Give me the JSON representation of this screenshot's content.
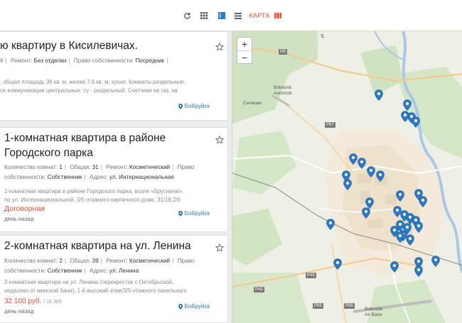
{
  "toolbar": {
    "refresh_icon": "refresh-icon",
    "grid_icon": "grid-view-icon",
    "tile_icon": "tile-view-icon",
    "list_icon": "list-view-icon",
    "map_label": "КАРТА",
    "map_icon": "map-icon",
    "active_color": "#2a7ac9",
    "accent_color": "#e0533b"
  },
  "listings": [
    {
      "title": "ю квартиру в Кисилевичах.",
      "params_1": "6",
      "params_1_label_repair": "Ремонт:",
      "params_1_repair": "Без отделки",
      "params_1_label_ownership": "Право собственности:",
      "params_1_ownership": "Посредник",
      "desc_1": ", общая площадь 36 кв. м, жилая 7,6 кв. м, кухня. Комнаты раздельные.",
      "desc_2": "се коммуникации центральные: су - раздельный. Счетчики на газ, на",
      "location": "Бобруйск"
    },
    {
      "title": "1-комнатная квартира в районе Городского парка",
      "label_rooms": "Количество комнат:",
      "rooms": "1",
      "label_area": "Общая:",
      "area": "31",
      "label_repair": "Ремонт:",
      "repair": "Косметический",
      "label_ownership_1": "Право",
      "label_ownership_2": "собственности:",
      "ownership": "Собственник",
      "label_address": "Адрес:",
      "address": "ул. Интернациональная",
      "desc_1": "1-комнатная квартира в районе Городского парка, возле «Брусничкі»,",
      "desc_2": "по ул. Интернациональной. 3/5-этажного кирпичного дома, 31/18,2/6",
      "price": "Договорная",
      "when": "день назад",
      "location": "Бобруйск"
    },
    {
      "title": "2-комнатная квартира на ул. Ленина",
      "label_rooms": "Количество комнат:",
      "rooms": "2",
      "label_area": "Общая:",
      "area": "39",
      "label_repair": "Ремонт:",
      "repair": "Косметический",
      "label_ownership_1": "Право",
      "label_ownership_2": "собственности:",
      "ownership": "Собственник",
      "label_address": "Адрес:",
      "address": "ул. Ленина",
      "desc_1": "2-комнатная квартира на ул. Ленина (перекресток с Октябрьской,",
      "desc_2": "недалеко от минской бани), 1-й высокий этаж/3/5-этажного панельного",
      "price": "32 100 руб.",
      "price_sub": "/ 16 369",
      "when": "день назад",
      "location": "Бобруйск"
    }
  ],
  "map": {
    "zoom_in": "+",
    "zoom_out": "−",
    "labels": {
      "m5": "M5",
      "bobruisk_airclub_1": "Bobruisk",
      "bobruisk_airclub_2": "Aeroclub",
      "sychkovo": "Сычково",
      "p67": "P67",
      "p43": "P43",
      "p43b": "P43",
      "p55": "P55",
      "p55b": "P55",
      "bobruisk_airbase_1": "Bobruisk",
      "bobruisk_airbase_2": "Air Base"
    },
    "marker_color": "#2a7ac9",
    "marker_icon": "map-marker-icon"
  }
}
